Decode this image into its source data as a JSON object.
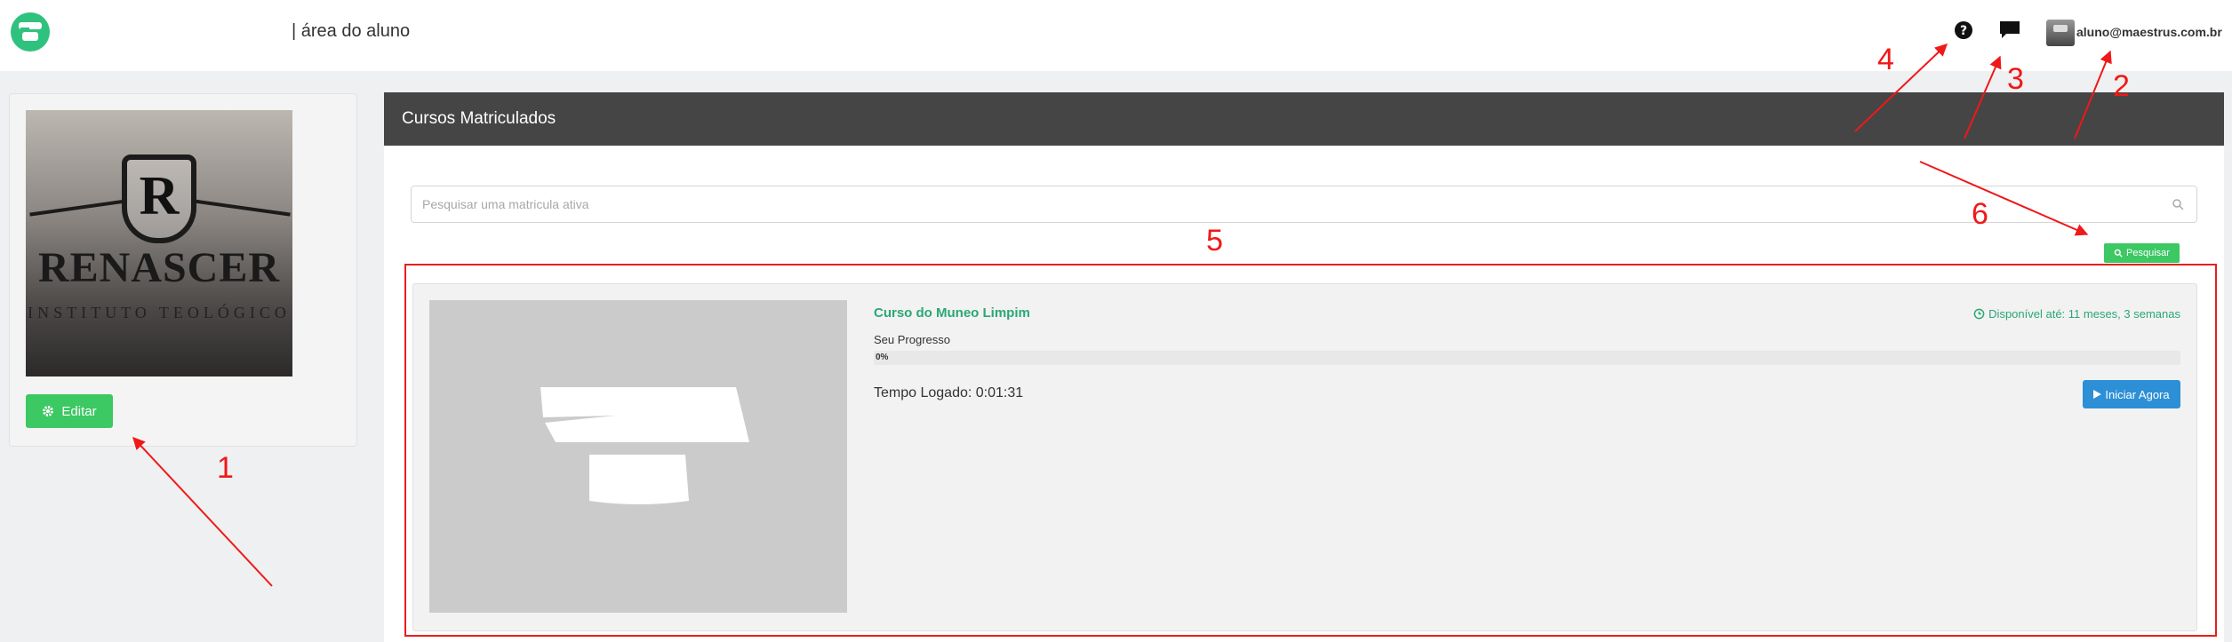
{
  "header": {
    "brand_text": "| área do aluno",
    "user_email": "aluno@maestrus.com.br"
  },
  "profile": {
    "logo_letter": "R",
    "logo_name": "RENASCER",
    "logo_subtitle": "INSTITUTO TEOLÓGICO",
    "edit_label": "Editar"
  },
  "main": {
    "panel_title": "Cursos Matriculados",
    "search_placeholder": "Pesquisar uma matricula ativa",
    "search_button_label": "Pesquisar"
  },
  "course": {
    "title": "Curso do Muneo Limpim",
    "availability": "Disponível até: 11 meses, 3 semanas",
    "progress_label": "Seu Progresso",
    "progress_text": "0%",
    "progress_value": 0,
    "time_logged": "Tempo Logado: 0:01:31",
    "start_label": "Iniciar Agora"
  },
  "annotations": {
    "labels": [
      "1",
      "2",
      "3",
      "4",
      "5",
      "6"
    ],
    "color": "#f01818"
  },
  "colors": {
    "accent_green": "#3cc862",
    "course_green": "#2aa775",
    "header_dark": "#454545",
    "start_blue": "#2d8fd5"
  }
}
